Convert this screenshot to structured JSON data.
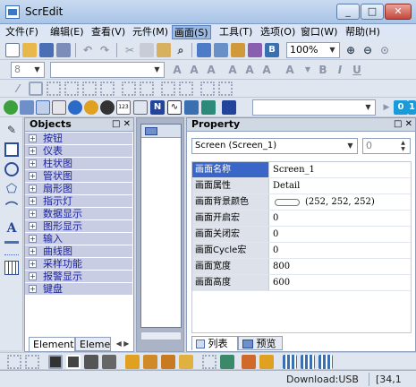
{
  "window": {
    "title": "ScrEdit",
    "buttons": [
      "_",
      "□",
      "✕"
    ]
  },
  "menu": [
    "文件(F)",
    "编辑(E)",
    "查看(V)",
    "元件(M)",
    "画面(S)",
    "工具(T)",
    "选项(O)",
    "窗口(W)",
    "帮助(H)"
  ],
  "toolbar": {
    "zoom_value": "100%",
    "font_size_value": "8",
    "spin_value": "0"
  },
  "objects_panel": {
    "title": "Objects",
    "head_buttons": "□ ✕",
    "items": [
      "按钮",
      "仪表",
      "柱状图",
      "管状图",
      "扇形图",
      "指示灯",
      "数据显示",
      "图形显示",
      "输入",
      "曲线图",
      "采样功能",
      "报警显示",
      "键盘"
    ],
    "tabs": [
      "Element",
      "Elemen"
    ]
  },
  "property_panel": {
    "title": "Property",
    "head_buttons": "□ ✕",
    "selector": "Screen (Screen_1)",
    "spin": "0",
    "rows": [
      {
        "key": "画面名称",
        "value": "Screen_1"
      },
      {
        "key": "画面属性",
        "value": "Detail"
      },
      {
        "key": "画面背景颜色",
        "value": "(252, 252, 252)"
      },
      {
        "key": "画面开启宏",
        "value": "0"
      },
      {
        "key": "画面关闭宏",
        "value": "0"
      },
      {
        "key": "画面Cycle宏",
        "value": "0"
      },
      {
        "key": "画面宽度",
        "value": "800"
      },
      {
        "key": "画面高度",
        "value": "600"
      }
    ],
    "tabs": [
      "列表",
      "预览"
    ]
  },
  "status": {
    "download": "Download:USB",
    "coords": "[34,1"
  },
  "colors": {
    "accent": "#3a66c8",
    "tree_bg": "#c9cde3",
    "tree_text": "#1b23a0"
  }
}
